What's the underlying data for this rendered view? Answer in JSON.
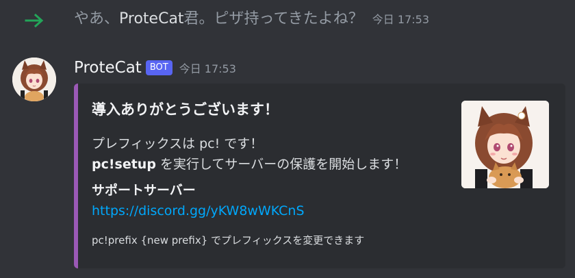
{
  "system_message": {
    "text_before": "やあ、",
    "mention": "ProteCat",
    "text_after": "君。ピザ持ってきたよね？",
    "timestamp": "今日 17:53",
    "icon": "join-arrow-icon",
    "icon_color": "#23a559"
  },
  "message": {
    "username": "ProteCat",
    "badge": "BOT",
    "timestamp": "今日 17:53",
    "avatar_icon": "anime-cat-girl-avatar",
    "embed": {
      "accent_color": "#9b59b6",
      "title": "導入ありがとうございます！",
      "description_line1": "プレフィックスは pc! です！",
      "description_line2_bold": "pc!setup",
      "description_line2_rest": " を実行してサーバーの保護を開始します！",
      "field_name": "サポートサーバー",
      "field_link": "https://discord.gg/yKW8wWKCnS",
      "footer": "pc!prefix {new prefix} でプレフィックスを変更できます",
      "thumbnail_icon": "anime-cat-girl-thumbnail"
    }
  },
  "colors": {
    "background": "#313338",
    "embed_background": "#2b2d31",
    "badge": "#5865f2",
    "link": "#00a8fc"
  }
}
